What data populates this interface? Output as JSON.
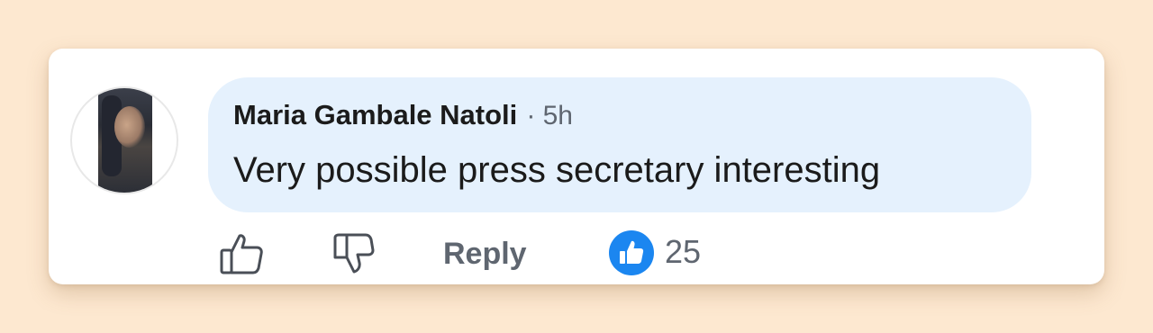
{
  "comment": {
    "author": "Maria Gambale Natoli",
    "separator": "·",
    "timestamp": "5h",
    "text": "Very possible press secretary interesting"
  },
  "actions": {
    "like_icon": "thumbs-up-outline-icon",
    "dislike_icon": "thumbs-down-outline-icon",
    "reply_label": "Reply",
    "reaction_icon": "thumbs-up-filled-icon",
    "reaction_count": "25"
  },
  "colors": {
    "page_background": "#fde8d0",
    "bubble_background": "#e5f1fd",
    "reaction_accent": "#1b86f0",
    "muted_text": "#5f6670"
  }
}
